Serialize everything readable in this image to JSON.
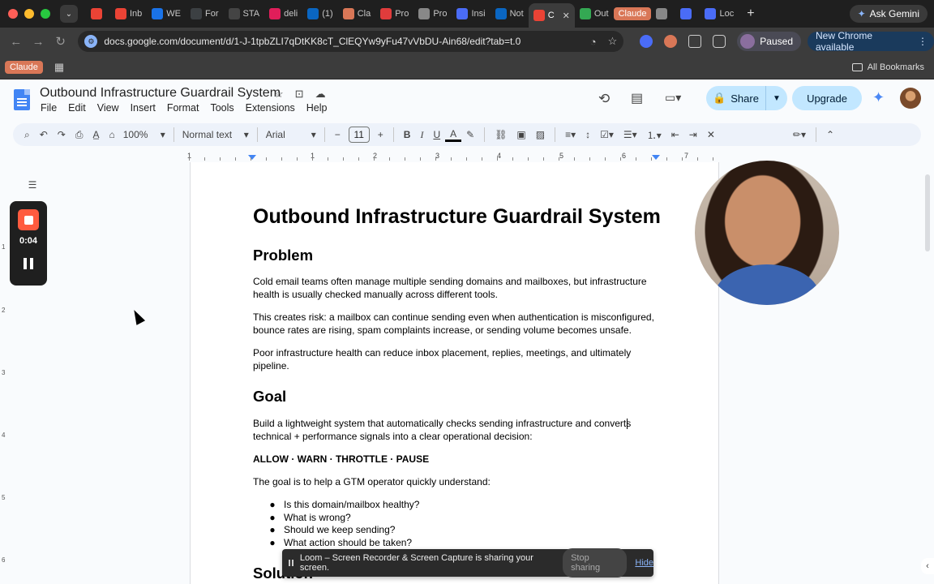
{
  "browser": {
    "tabs": [
      {
        "label": "",
        "color": "#ea4335",
        "active": false
      },
      {
        "label": "Inb",
        "color": "#ea4335",
        "active": false
      },
      {
        "label": "WE",
        "color": "#1a73e8",
        "active": false
      },
      {
        "label": "For",
        "color": "#3c4043",
        "active": false
      },
      {
        "label": "STA",
        "color": "#444",
        "active": false
      },
      {
        "label": "deli",
        "color": "#e01e5a",
        "active": false
      },
      {
        "label": "(1)",
        "color": "#0a66c2",
        "active": false
      },
      {
        "label": "Cla",
        "color": "#d97757",
        "active": false
      },
      {
        "label": "Pro",
        "color": "#e03c3c",
        "active": false
      },
      {
        "label": "Pro",
        "color": "#888",
        "active": false
      },
      {
        "label": "Insi",
        "color": "#4a6cf7",
        "active": false
      },
      {
        "label": "Not",
        "color": "#0a66c2",
        "active": false
      },
      {
        "label": "C",
        "color": "#ea4335",
        "active": true
      },
      {
        "label": "Out",
        "color": "#34a853",
        "active": false
      }
    ],
    "claude_tab": "Claude",
    "tabs_after": [
      {
        "label": "",
        "color": "#888"
      },
      {
        "label": "",
        "color": "#4a6cf7"
      },
      {
        "label": "Loc",
        "color": "#4a6cf7"
      }
    ],
    "new_tab": "+",
    "ask_gemini": "Ask Gemini",
    "url": "docs.google.com/document/d/1-J-1tpbZLI7qDtKK8cT_ClEQYw9yFu47vVbDU-Ain68/edit?tab=t.0",
    "profile_status": "Paused",
    "update_notice": "New Chrome available",
    "bookmark_claude": "Claude",
    "all_bookmarks": "All Bookmarks"
  },
  "docs": {
    "title": "Outbound Infrastructure Guardrail System",
    "menu": [
      "File",
      "Edit",
      "View",
      "Insert",
      "Format",
      "Tools",
      "Extensions",
      "Help"
    ],
    "share_label": "Share",
    "upgrade_label": "Upgrade",
    "toolbar": {
      "zoom": "100%",
      "style": "Normal text",
      "font": "Arial",
      "font_size": "11"
    },
    "ruler_numbers": [
      "1",
      "1",
      "2",
      "3",
      "4",
      "5",
      "6",
      "7"
    ],
    "vruler_numbers": [
      "1",
      "2",
      "3",
      "4",
      "5",
      "6"
    ]
  },
  "loom": {
    "timer": "0:04",
    "banner_text": "Loom – Screen Recorder & Screen Capture is sharing your screen.",
    "stop_sharing": "Stop sharing",
    "hide": "Hide"
  },
  "document": {
    "heading": "Outbound Infrastructure Guardrail System",
    "problem_heading": "Problem",
    "problem_p1": "Cold email teams often manage multiple sending domains and mailboxes, but infrastructure health is usually checked manually across different tools.",
    "problem_p2": "This creates risk: a mailbox can continue sending even when authentication is misconfigured, bounce rates are rising, spam complaints increase, or sending volume becomes unsafe.",
    "problem_p3": "Poor infrastructure health can reduce inbox placement, replies, meetings, and ultimately pipeline.",
    "goal_heading": "Goal",
    "goal_p1": "Build a lightweight system that automatically checks sending infrastructure and converts technical + performance signals into a clear operational decision:",
    "decisions": "ALLOW · WARN · THROTTLE · PAUSE",
    "goal_p2": "The goal is to help a GTM operator quickly understand:",
    "bullets": [
      "Is this domain/mailbox healthy?",
      "What is wrong?",
      "Should we keep sending?",
      "What action should be taken?"
    ],
    "solution_heading": "Solution"
  }
}
